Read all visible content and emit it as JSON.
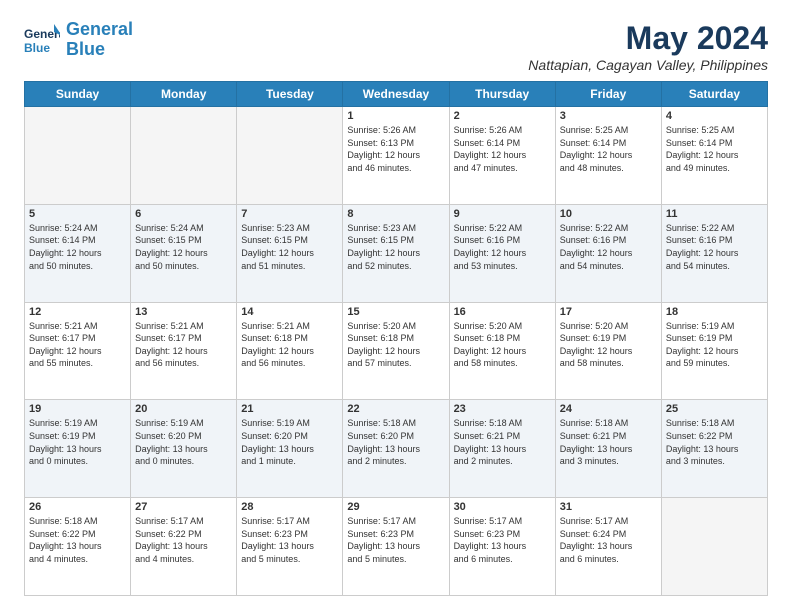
{
  "logo": {
    "line1": "General",
    "line2": "Blue"
  },
  "header": {
    "month_year": "May 2024",
    "location": "Nattapian, Cagayan Valley, Philippines"
  },
  "days_of_week": [
    "Sunday",
    "Monday",
    "Tuesday",
    "Wednesday",
    "Thursday",
    "Friday",
    "Saturday"
  ],
  "weeks": [
    [
      {
        "day": "",
        "info": ""
      },
      {
        "day": "",
        "info": ""
      },
      {
        "day": "",
        "info": ""
      },
      {
        "day": "1",
        "info": "Sunrise: 5:26 AM\nSunset: 6:13 PM\nDaylight: 12 hours\nand 46 minutes."
      },
      {
        "day": "2",
        "info": "Sunrise: 5:26 AM\nSunset: 6:14 PM\nDaylight: 12 hours\nand 47 minutes."
      },
      {
        "day": "3",
        "info": "Sunrise: 5:25 AM\nSunset: 6:14 PM\nDaylight: 12 hours\nand 48 minutes."
      },
      {
        "day": "4",
        "info": "Sunrise: 5:25 AM\nSunset: 6:14 PM\nDaylight: 12 hours\nand 49 minutes."
      }
    ],
    [
      {
        "day": "5",
        "info": "Sunrise: 5:24 AM\nSunset: 6:14 PM\nDaylight: 12 hours\nand 50 minutes."
      },
      {
        "day": "6",
        "info": "Sunrise: 5:24 AM\nSunset: 6:15 PM\nDaylight: 12 hours\nand 50 minutes."
      },
      {
        "day": "7",
        "info": "Sunrise: 5:23 AM\nSunset: 6:15 PM\nDaylight: 12 hours\nand 51 minutes."
      },
      {
        "day": "8",
        "info": "Sunrise: 5:23 AM\nSunset: 6:15 PM\nDaylight: 12 hours\nand 52 minutes."
      },
      {
        "day": "9",
        "info": "Sunrise: 5:22 AM\nSunset: 6:16 PM\nDaylight: 12 hours\nand 53 minutes."
      },
      {
        "day": "10",
        "info": "Sunrise: 5:22 AM\nSunset: 6:16 PM\nDaylight: 12 hours\nand 54 minutes."
      },
      {
        "day": "11",
        "info": "Sunrise: 5:22 AM\nSunset: 6:16 PM\nDaylight: 12 hours\nand 54 minutes."
      }
    ],
    [
      {
        "day": "12",
        "info": "Sunrise: 5:21 AM\nSunset: 6:17 PM\nDaylight: 12 hours\nand 55 minutes."
      },
      {
        "day": "13",
        "info": "Sunrise: 5:21 AM\nSunset: 6:17 PM\nDaylight: 12 hours\nand 56 minutes."
      },
      {
        "day": "14",
        "info": "Sunrise: 5:21 AM\nSunset: 6:18 PM\nDaylight: 12 hours\nand 56 minutes."
      },
      {
        "day": "15",
        "info": "Sunrise: 5:20 AM\nSunset: 6:18 PM\nDaylight: 12 hours\nand 57 minutes."
      },
      {
        "day": "16",
        "info": "Sunrise: 5:20 AM\nSunset: 6:18 PM\nDaylight: 12 hours\nand 58 minutes."
      },
      {
        "day": "17",
        "info": "Sunrise: 5:20 AM\nSunset: 6:19 PM\nDaylight: 12 hours\nand 58 minutes."
      },
      {
        "day": "18",
        "info": "Sunrise: 5:19 AM\nSunset: 6:19 PM\nDaylight: 12 hours\nand 59 minutes."
      }
    ],
    [
      {
        "day": "19",
        "info": "Sunrise: 5:19 AM\nSunset: 6:19 PM\nDaylight: 13 hours\nand 0 minutes."
      },
      {
        "day": "20",
        "info": "Sunrise: 5:19 AM\nSunset: 6:20 PM\nDaylight: 13 hours\nand 0 minutes."
      },
      {
        "day": "21",
        "info": "Sunrise: 5:19 AM\nSunset: 6:20 PM\nDaylight: 13 hours\nand 1 minute."
      },
      {
        "day": "22",
        "info": "Sunrise: 5:18 AM\nSunset: 6:20 PM\nDaylight: 13 hours\nand 2 minutes."
      },
      {
        "day": "23",
        "info": "Sunrise: 5:18 AM\nSunset: 6:21 PM\nDaylight: 13 hours\nand 2 minutes."
      },
      {
        "day": "24",
        "info": "Sunrise: 5:18 AM\nSunset: 6:21 PM\nDaylight: 13 hours\nand 3 minutes."
      },
      {
        "day": "25",
        "info": "Sunrise: 5:18 AM\nSunset: 6:22 PM\nDaylight: 13 hours\nand 3 minutes."
      }
    ],
    [
      {
        "day": "26",
        "info": "Sunrise: 5:18 AM\nSunset: 6:22 PM\nDaylight: 13 hours\nand 4 minutes."
      },
      {
        "day": "27",
        "info": "Sunrise: 5:17 AM\nSunset: 6:22 PM\nDaylight: 13 hours\nand 4 minutes."
      },
      {
        "day": "28",
        "info": "Sunrise: 5:17 AM\nSunset: 6:23 PM\nDaylight: 13 hours\nand 5 minutes."
      },
      {
        "day": "29",
        "info": "Sunrise: 5:17 AM\nSunset: 6:23 PM\nDaylight: 13 hours\nand 5 minutes."
      },
      {
        "day": "30",
        "info": "Sunrise: 5:17 AM\nSunset: 6:23 PM\nDaylight: 13 hours\nand 6 minutes."
      },
      {
        "day": "31",
        "info": "Sunrise: 5:17 AM\nSunset: 6:24 PM\nDaylight: 13 hours\nand 6 minutes."
      },
      {
        "day": "",
        "info": ""
      }
    ]
  ]
}
